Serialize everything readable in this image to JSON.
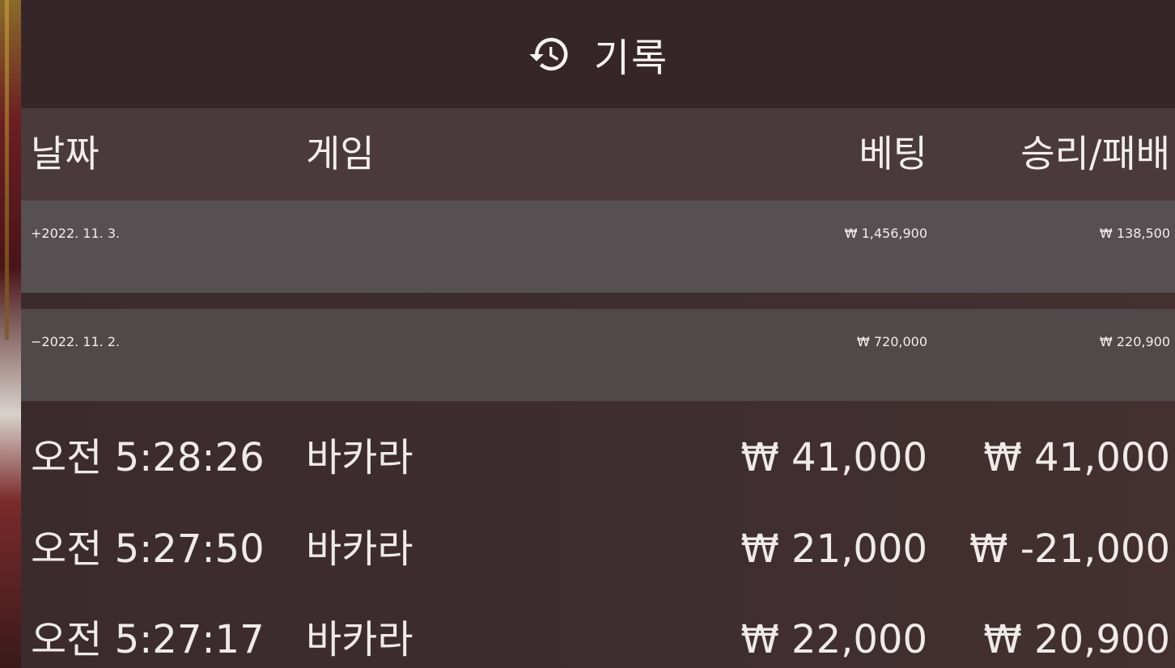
{
  "header": {
    "icon": "history-icon",
    "title": "기록"
  },
  "columns": {
    "date": "날짜",
    "game": "게임",
    "bet": "베팅",
    "result": "승리/패배"
  },
  "groups": [
    {
      "toggle_date": "+2022. 11. 3.",
      "bet": "₩ 1,456,900",
      "result": "₩ 138,500",
      "expanded": false
    },
    {
      "toggle_date": "−2022. 11. 2.",
      "bet": "₩ 720,000",
      "result": "₩ 220,900",
      "expanded": true
    }
  ],
  "entries": [
    {
      "time": "오전 5:28:26",
      "game": "바카라",
      "bet": "₩ 41,000",
      "result": "₩ 41,000"
    },
    {
      "time": "오전 5:27:50",
      "game": "바카라",
      "bet": "₩ 21,000",
      "result": "₩ -21,000"
    },
    {
      "time": "오전 5:27:17",
      "game": "바카라",
      "bet": "₩ 22,000",
      "result": "₩ 20,900"
    }
  ]
}
